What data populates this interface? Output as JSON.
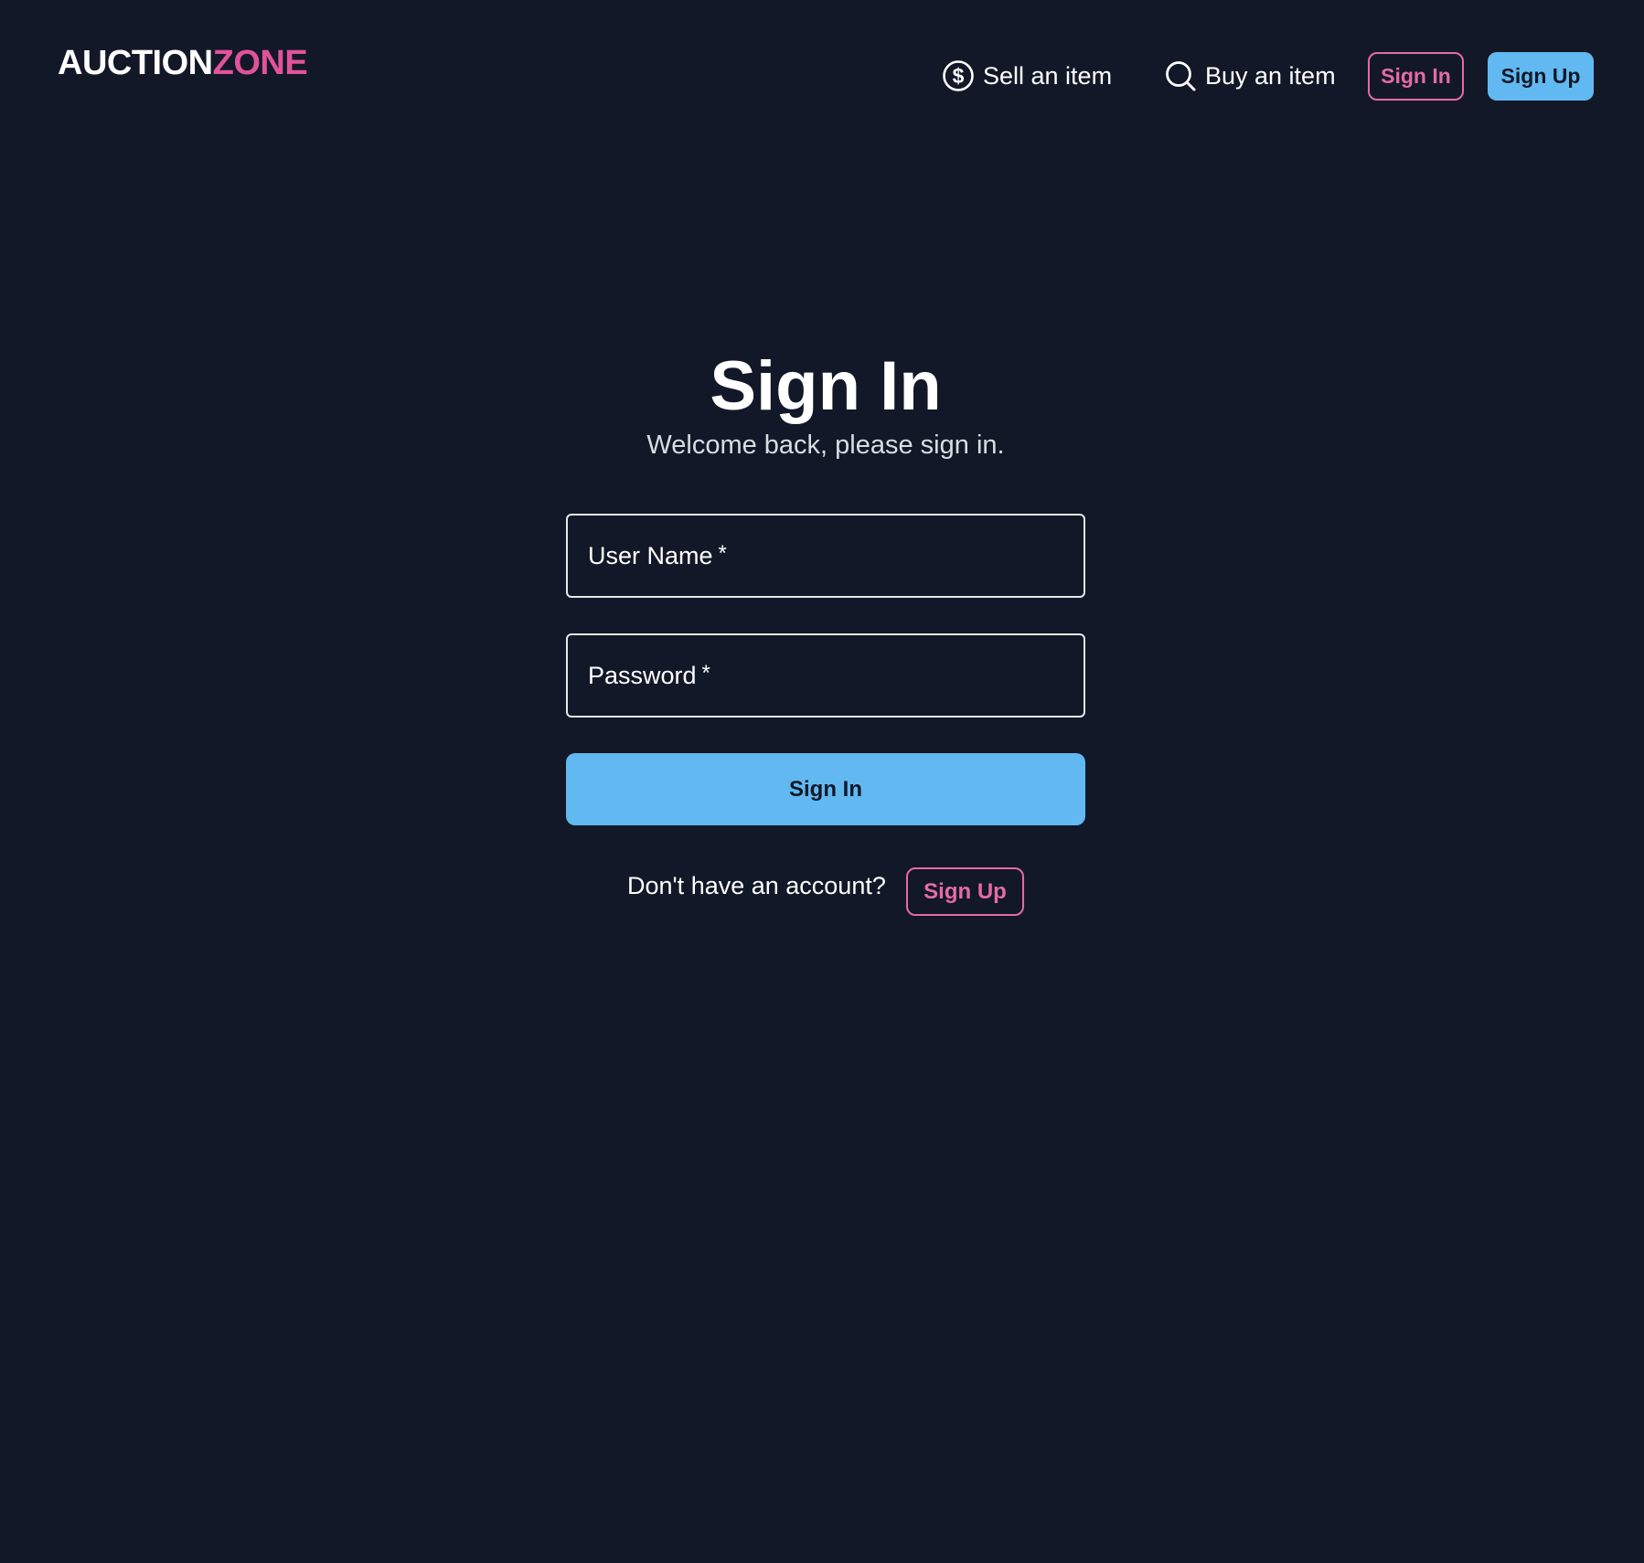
{
  "header": {
    "logo_part1": "AUCTION",
    "logo_part2": "ZONE",
    "nav": {
      "sell_label": "Sell an item",
      "sell_icon": "dollar-circle-icon",
      "buy_label": "Buy an item",
      "buy_icon": "search-icon"
    },
    "signin_label": "Sign In",
    "signup_label": "Sign Up"
  },
  "main": {
    "title": "Sign In",
    "subtitle": "Welcome back, please sign in.",
    "username_label": "User Name",
    "password_label": "Password",
    "required_marker": "*",
    "submit_label": "Sign In",
    "no_account_text": "Don't have an account?",
    "signup_label": "Sign Up"
  },
  "colors": {
    "background": "#121827",
    "accent_pink": "#e0539a",
    "accent_blue": "#62b9f1",
    "text": "#ffffff",
    "muted_text": "#d9dde3"
  }
}
